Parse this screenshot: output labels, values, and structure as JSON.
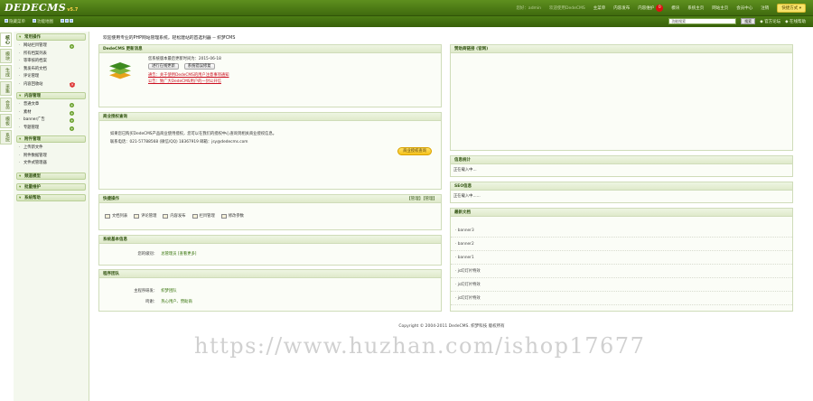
{
  "header": {
    "logo_text": "DEDECMS",
    "logo_ver": "v5.7",
    "nav": [
      {
        "label": "您好：admin",
        "dim": true
      },
      {
        "label": "欢迎使用DedeCMS",
        "dim": true
      },
      {
        "label": "主菜单"
      },
      {
        "label": "内容发布"
      },
      {
        "label": "内容维护"
      },
      {
        "label": "模块"
      },
      {
        "label": "系统主页"
      },
      {
        "label": "网站主页"
      },
      {
        "label": "会员中心"
      },
      {
        "label": "注销"
      }
    ],
    "notify_count": "0",
    "quick_label": "快捷方式 ▾"
  },
  "subbar": {
    "items": [
      "隐藏菜单",
      "功能地图"
    ],
    "search_placeholder": "功能搜索",
    "search_button": "搜索",
    "forum": "官方论坛",
    "help": "在线帮助"
  },
  "vtabs": [
    "核心",
    "模块",
    "生成",
    "采集",
    "会员",
    "模板",
    "系统"
  ],
  "menu": {
    "groups": [
      {
        "title": "常用操作",
        "items": [
          {
            "label": "网站栏目管理",
            "mark": "plus"
          },
          {
            "label": "所有档案列表"
          },
          {
            "label": "等审核的档案"
          },
          {
            "label": "我发布的文档"
          },
          {
            "label": "评论管理"
          },
          {
            "label": "内容回收站",
            "mark": "shield"
          }
        ]
      },
      {
        "title": "内容管理",
        "items": [
          {
            "label": "普通文章",
            "mark": "plus"
          },
          {
            "label": "素材",
            "mark": "plus"
          },
          {
            "label": "banner广告",
            "mark": "plus"
          },
          {
            "label": "专题管理",
            "mark": "plus"
          }
        ]
      },
      {
        "title": "附件管理",
        "items": [
          {
            "label": "上传新文件"
          },
          {
            "label": "附件数据管理"
          },
          {
            "label": "文件式管理器"
          }
        ]
      },
      {
        "title": "频道模型",
        "items": []
      },
      {
        "title": "批量维护",
        "items": []
      },
      {
        "title": "系统帮助",
        "items": []
      }
    ]
  },
  "main": {
    "welcome": "欢迎使用专业的PHP网站管理系统，轻松建站的首选利器 -- 织梦CMS",
    "update_panel": {
      "title": "DedeCMS 更新消息",
      "release_line": "您系统版本最后更新时间为：2015-06-18",
      "btn_check": "进行在线更新",
      "btn_repair": "系统错误修复",
      "notice1": "通告：关于使用DedeCMS的用户注意事项通知",
      "notice2": "公告：致广大DedeCMS用户的一封公开信"
    },
    "auth_panel": {
      "title": "商业授权查询",
      "text": "如果您已购买DedeCMS产品商业使用授权，您可以在我们的授权中心查询到相关商业授权信息。",
      "contact": "联系电话：021-57788568  (微信/QQ) 18367919  邮箱：jsy@dedecms.com",
      "button": "商业授权查询"
    },
    "quick_panel": {
      "title": "快捷操作",
      "actions": "【管理】【管理】",
      "items": [
        "文档列表",
        "评论管理",
        "内容发布",
        "栏目管理",
        "修改参数"
      ]
    },
    "sysinfo_panel": {
      "title": "系统基本信息",
      "key": "您的级别：",
      "value": "总管理员 [查看更多]"
    },
    "team_panel": {
      "title": "程序团队",
      "rows": [
        {
          "k": "主程序研发：",
          "v": "织梦团队"
        },
        {
          "k": "鸣谢：",
          "v": "热心用户、赞助商"
        }
      ]
    },
    "links_panel": {
      "title": "赞助商链接 (官网)"
    },
    "info_panel": {
      "title": "信息统计",
      "text": "正在载入中..."
    },
    "seo_panel": {
      "title": "SEO信息",
      "text": "正在载入中......"
    },
    "latest_panel": {
      "title": "最新文档",
      "items": [
        "banner3",
        "banner2",
        "banner1",
        "js幻灯片特效",
        "js幻灯片特效",
        "js幻灯片特效"
      ]
    }
  },
  "footer": "Copyright © 2004-2011 DedeCMS. 织梦科技 版权所有",
  "watermark": "https://www.huzhan.com/ishop17677",
  "colors": {
    "header": "#4d7d15",
    "panel_border": "#cfdcb9",
    "accent": "#f6c21a"
  }
}
